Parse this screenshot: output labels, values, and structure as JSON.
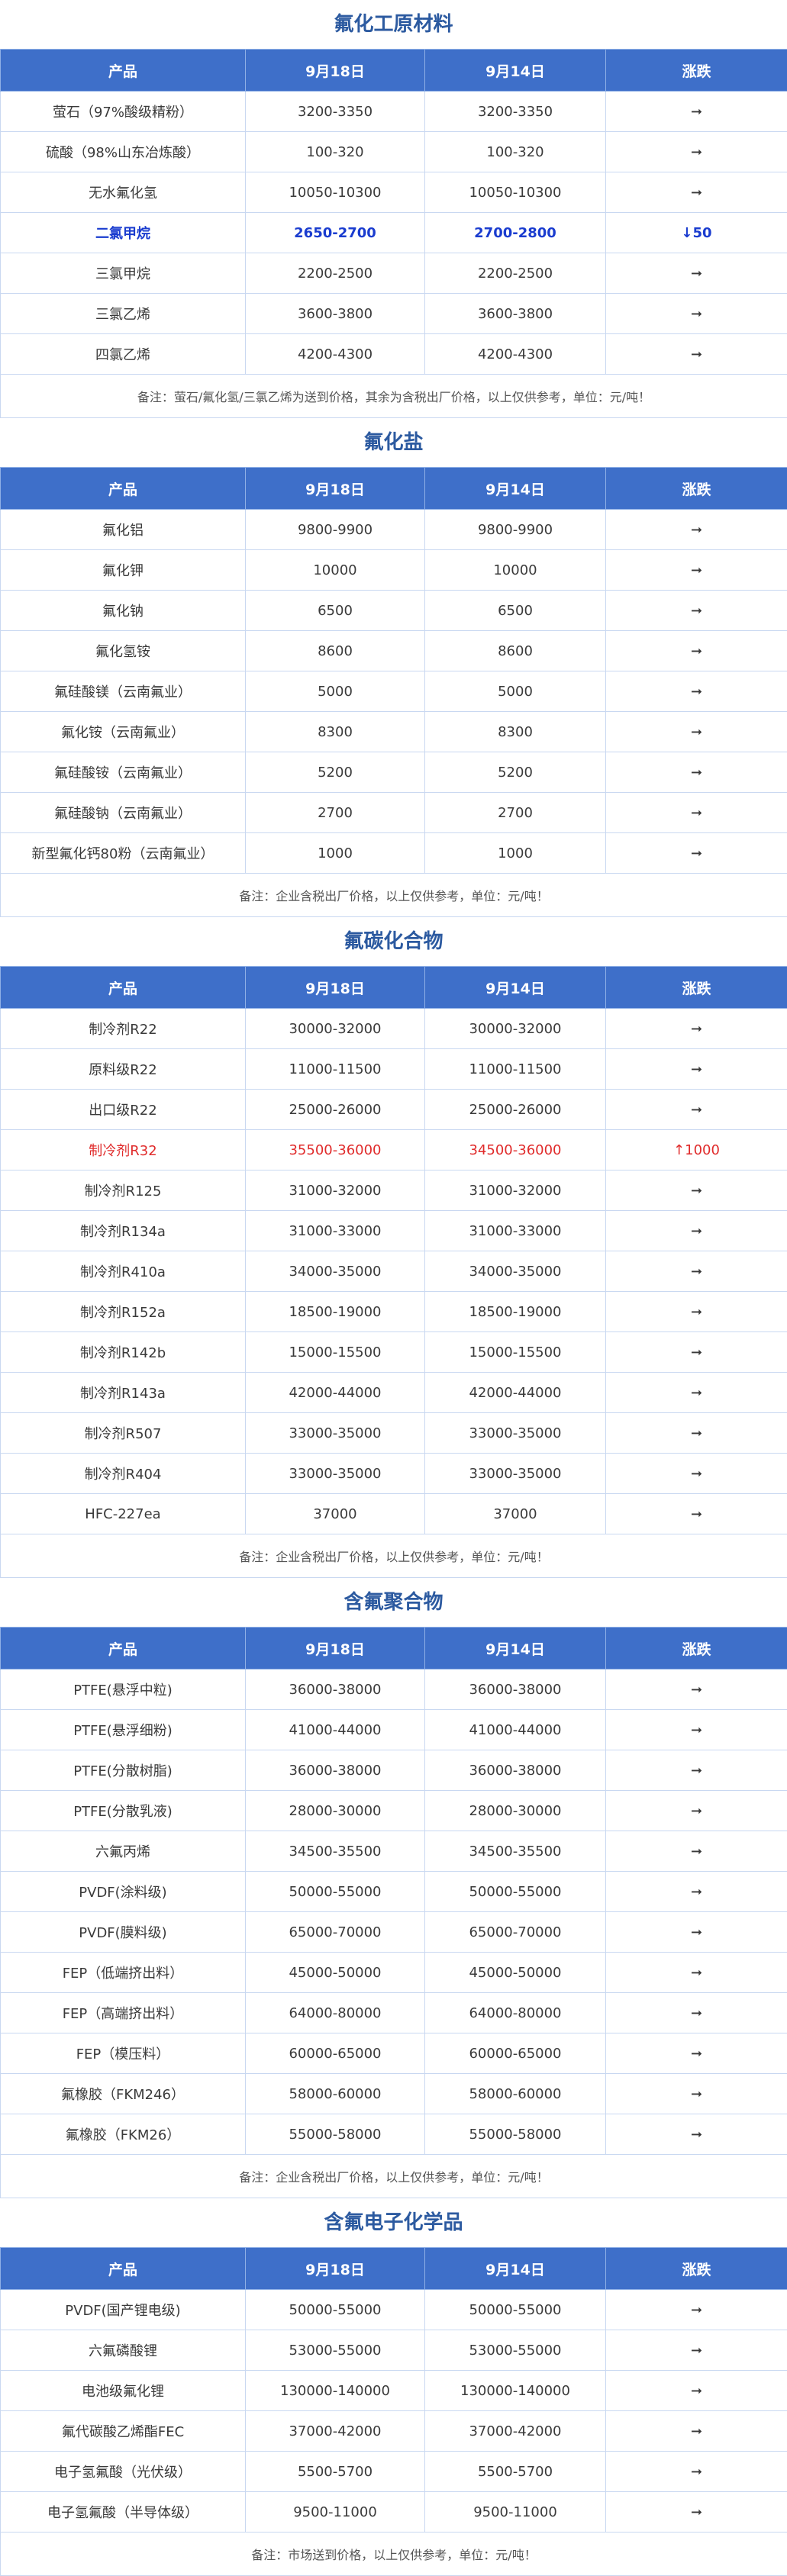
{
  "header_row": [
    "产品",
    "9月18日",
    "9月14日",
    "涨跌"
  ],
  "sections": [
    {
      "title": "氟化工原材料",
      "rows": [
        {
          "product": "萤石（97%酸级精粉）",
          "d1": "3200-3350",
          "d2": "3200-3350",
          "chg": "➞",
          "hl": ""
        },
        {
          "product": "硫酸（98%山东冶炼酸）",
          "d1": "100-320",
          "d2": "100-320",
          "chg": "➞",
          "hl": ""
        },
        {
          "product": "无水氟化氢",
          "d1": "10050-10300",
          "d2": "10050-10300",
          "chg": "➞",
          "hl": ""
        },
        {
          "product": "二氯甲烷",
          "d1": "2650-2700",
          "d2": "2700-2800",
          "chg": "↓50",
          "hl": "blue"
        },
        {
          "product": "三氯甲烷",
          "d1": "2200-2500",
          "d2": "2200-2500",
          "chg": "➞",
          "hl": ""
        },
        {
          "product": "三氯乙烯",
          "d1": "3600-3800",
          "d2": "3600-3800",
          "chg": "➞",
          "hl": ""
        },
        {
          "product": "四氯乙烯",
          "d1": "4200-4300",
          "d2": "4200-4300",
          "chg": "➞",
          "hl": ""
        }
      ],
      "note": "备注：萤石/氟化氢/三氯乙烯为送到价格，其余为含税出厂价格，以上仅供参考，单位：元/吨！"
    },
    {
      "title": "氟化盐",
      "rows": [
        {
          "product": "氟化铝",
          "d1": "9800-9900",
          "d2": "9800-9900",
          "chg": "➞",
          "hl": ""
        },
        {
          "product": "氟化钾",
          "d1": "10000",
          "d2": "10000",
          "chg": "➞",
          "hl": ""
        },
        {
          "product": "氟化钠",
          "d1": "6500",
          "d2": "6500",
          "chg": "➞",
          "hl": ""
        },
        {
          "product": "氟化氢铵",
          "d1": "8600",
          "d2": "8600",
          "chg": "➞",
          "hl": ""
        },
        {
          "product": "氟硅酸镁（云南氟业）",
          "d1": "5000",
          "d2": "5000",
          "chg": "➞",
          "hl": ""
        },
        {
          "product": "氟化铵（云南氟业）",
          "d1": "8300",
          "d2": "8300",
          "chg": "➞",
          "hl": ""
        },
        {
          "product": "氟硅酸铵（云南氟业）",
          "d1": "5200",
          "d2": "5200",
          "chg": "➞",
          "hl": ""
        },
        {
          "product": "氟硅酸钠（云南氟业）",
          "d1": "2700",
          "d2": "2700",
          "chg": "➞",
          "hl": ""
        },
        {
          "product": "新型氟化钙80粉（云南氟业）",
          "d1": "1000",
          "d2": "1000",
          "chg": "➞",
          "hl": ""
        }
      ],
      "note": "备注：企业含税出厂价格，以上仅供参考，单位：元/吨！"
    },
    {
      "title": "氟碳化合物",
      "rows": [
        {
          "product": "制冷剂R22",
          "d1": "30000-32000",
          "d2": "30000-32000",
          "chg": "➞",
          "hl": ""
        },
        {
          "product": "原料级R22",
          "d1": "11000-11500",
          "d2": "11000-11500",
          "chg": "➞",
          "hl": ""
        },
        {
          "product": "出口级R22",
          "d1": "25000-26000",
          "d2": "25000-26000",
          "chg": "➞",
          "hl": ""
        },
        {
          "product": "制冷剂R32",
          "d1": "35500-36000",
          "d2": "34500-36000",
          "chg": "↑1000",
          "hl": "red"
        },
        {
          "product": "制冷剂R125",
          "d1": "31000-32000",
          "d2": "31000-32000",
          "chg": "➞",
          "hl": ""
        },
        {
          "product": "制冷剂R134a",
          "d1": "31000-33000",
          "d2": "31000-33000",
          "chg": "➞",
          "hl": ""
        },
        {
          "product": "制冷剂R410a",
          "d1": "34000-35000",
          "d2": "34000-35000",
          "chg": "➞",
          "hl": ""
        },
        {
          "product": "制冷剂R152a",
          "d1": "18500-19000",
          "d2": "18500-19000",
          "chg": "➞",
          "hl": ""
        },
        {
          "product": "制冷剂R142b",
          "d1": "15000-15500",
          "d2": "15000-15500",
          "chg": "➞",
          "hl": ""
        },
        {
          "product": "制冷剂R143a",
          "d1": "42000-44000",
          "d2": "42000-44000",
          "chg": "➞",
          "hl": ""
        },
        {
          "product": "制冷剂R507",
          "d1": "33000-35000",
          "d2": "33000-35000",
          "chg": "➞",
          "hl": ""
        },
        {
          "product": "制冷剂R404",
          "d1": "33000-35000",
          "d2": "33000-35000",
          "chg": "➞",
          "hl": ""
        },
        {
          "product": "HFC-227ea",
          "d1": "37000",
          "d2": "37000",
          "chg": "➞",
          "hl": ""
        }
      ],
      "note": "备注：企业含税出厂价格，以上仅供参考，单位：元/吨！"
    },
    {
      "title": "含氟聚合物",
      "rows": [
        {
          "product": "PTFE(悬浮中粒)",
          "d1": "36000-38000",
          "d2": "36000-38000",
          "chg": "➞",
          "hl": ""
        },
        {
          "product": "PTFE(悬浮细粉)",
          "d1": "41000-44000",
          "d2": "41000-44000",
          "chg": "➞",
          "hl": ""
        },
        {
          "product": "PTFE(分散树脂)",
          "d1": "36000-38000",
          "d2": "36000-38000",
          "chg": "➞",
          "hl": ""
        },
        {
          "product": "PTFE(分散乳液)",
          "d1": "28000-30000",
          "d2": "28000-30000",
          "chg": "➞",
          "hl": ""
        },
        {
          "product": "六氟丙烯",
          "d1": "34500-35500",
          "d2": "34500-35500",
          "chg": "➞",
          "hl": ""
        },
        {
          "product": "PVDF(涂料级)",
          "d1": "50000-55000",
          "d2": "50000-55000",
          "chg": "➞",
          "hl": ""
        },
        {
          "product": "PVDF(膜料级)",
          "d1": "65000-70000",
          "d2": "65000-70000",
          "chg": "➞",
          "hl": ""
        },
        {
          "product": "FEP（低端挤出料）",
          "d1": "45000-50000",
          "d2": "45000-50000",
          "chg": "➞",
          "hl": ""
        },
        {
          "product": "FEP（高端挤出料）",
          "d1": "64000-80000",
          "d2": "64000-80000",
          "chg": "➞",
          "hl": ""
        },
        {
          "product": "FEP（模压料）",
          "d1": "60000-65000",
          "d2": "60000-65000",
          "chg": "➞",
          "hl": ""
        },
        {
          "product": "氟橡胶（FKM246）",
          "d1": "58000-60000",
          "d2": "58000-60000",
          "chg": "➞",
          "hl": ""
        },
        {
          "product": "氟橡胶（FKM26）",
          "d1": "55000-58000",
          "d2": "55000-58000",
          "chg": "➞",
          "hl": ""
        }
      ],
      "note": "备注：企业含税出厂价格，以上仅供参考，单位：元/吨！"
    },
    {
      "title": "含氟电子化学品",
      "rows": [
        {
          "product": "PVDF(国产锂电级)",
          "d1": "50000-55000",
          "d2": "50000-55000",
          "chg": "➞",
          "hl": ""
        },
        {
          "product": "六氟磷酸锂",
          "d1": "53000-55000",
          "d2": "53000-55000",
          "chg": "➞",
          "hl": ""
        },
        {
          "product": "电池级氟化锂",
          "d1": "130000-140000",
          "d2": "130000-140000",
          "chg": "➞",
          "hl": ""
        },
        {
          "product": "氟代碳酸乙烯酯FEC",
          "d1": "37000-42000",
          "d2": "37000-42000",
          "chg": "➞",
          "hl": ""
        },
        {
          "product": "电子氢氟酸（光伏级）",
          "d1": "5500-5700",
          "d2": "5500-5700",
          "chg": "➞",
          "hl": ""
        },
        {
          "product": "电子氢氟酸（半导体级）",
          "d1": "9500-11000",
          "d2": "9500-11000",
          "chg": "➞",
          "hl": ""
        }
      ],
      "note": "备注：市场送到价格，以上仅供参考，单位：元/吨！"
    }
  ]
}
